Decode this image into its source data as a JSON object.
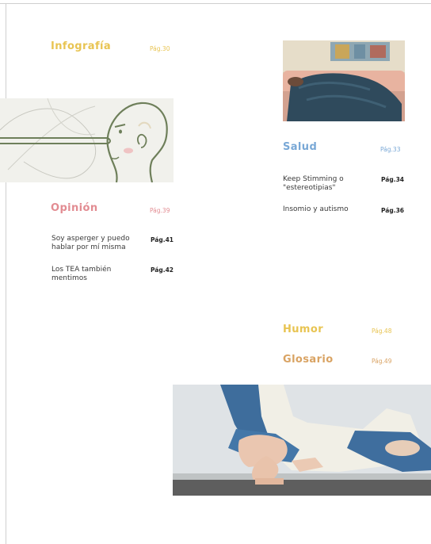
{
  "sections": {
    "infografia": {
      "title": "Infografía",
      "page": "Pág.30"
    },
    "opinion": {
      "title": "Opinión",
      "page": "Pág.39",
      "entries": [
        {
          "text": "Soy asperger y puedo hablar por mí misma",
          "page": "Pág.41"
        },
        {
          "text": "Los TEA también mentimos",
          "page": "Pág.42"
        }
      ]
    },
    "salud": {
      "title": "Salud",
      "page": "Pág.33",
      "entries": [
        {
          "text": "Keep Stimming o \"estereotipias\"",
          "page": "Pág.34"
        },
        {
          "text": "Insomio y autismo",
          "page": "Pág.36"
        }
      ]
    },
    "humor": {
      "title": "Humor",
      "page": "Pág.48"
    },
    "glosario": {
      "title": "Glosario",
      "page": "Pág.49"
    }
  },
  "colors": {
    "infografia": "#e8c452",
    "opinion": "#e28c92",
    "salud": "#79a8d6",
    "humor": "#e8c452",
    "glosario": "#d9a363"
  },
  "images": {
    "illustration": "pinocchio-line-drawing",
    "photo_sleep": "person-under-blanket-on-sofa",
    "photo_sitting": "person-sitting-cross-legged-barefoot"
  }
}
